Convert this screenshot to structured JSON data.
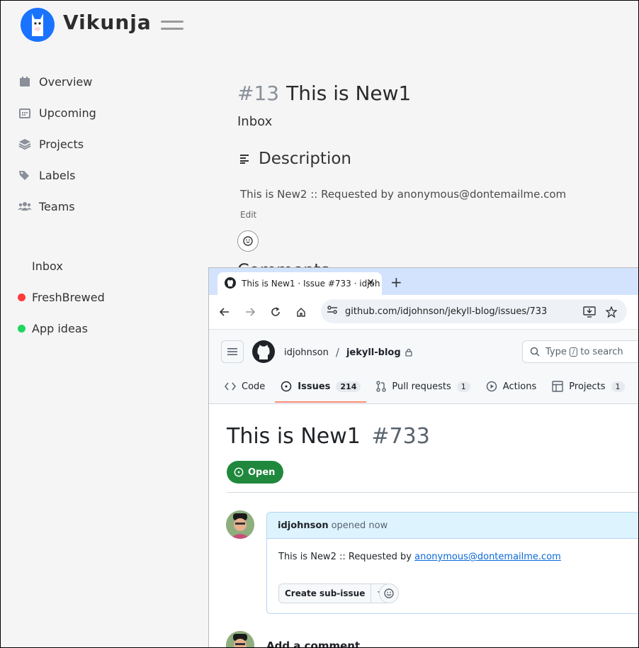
{
  "vikunja": {
    "brand": "Vikunja",
    "nav": [
      {
        "label": "Overview",
        "icon": "calendar-icon"
      },
      {
        "label": "Upcoming",
        "icon": "calendar-grid-icon"
      },
      {
        "label": "Projects",
        "icon": "layers-icon"
      },
      {
        "label": "Labels",
        "icon": "tags-icon"
      },
      {
        "label": "Teams",
        "icon": "users-icon"
      }
    ],
    "projects": [
      {
        "label": "Inbox",
        "color": ""
      },
      {
        "label": "FreshBrewed",
        "color": "#ff3b3b"
      },
      {
        "label": "App ideas",
        "color": "#1ed760"
      }
    ],
    "task": {
      "number": "#13",
      "title": "This is New1",
      "project": "Inbox",
      "description_heading": "Description",
      "description": "This is New2 :: Requested by anonymous@dontemailme.com",
      "edit_label": "Edit",
      "comments_heading": "Comments"
    }
  },
  "browser": {
    "tab_title": "This is New1 · Issue #733 · idjoh",
    "url": "github.com/idjohnson/jekyll-blog/issues/733"
  },
  "github": {
    "owner": "idjohnson",
    "repo": "jekyll-blog",
    "search_prefix": "Type",
    "search_key": "/",
    "search_suffix": "to search",
    "tabs": [
      {
        "label": "Code",
        "count": ""
      },
      {
        "label": "Issues",
        "count": "214"
      },
      {
        "label": "Pull requests",
        "count": "1"
      },
      {
        "label": "Actions",
        "count": ""
      },
      {
        "label": "Projects",
        "count": "1"
      }
    ],
    "issue": {
      "title": "This is New1",
      "number": "#733",
      "state": "Open",
      "comment_author": "idjohnson",
      "comment_meta": "opened now",
      "comment_text": "This is New2 :: Requested by ",
      "comment_link": "anonymous@dontemailme.com",
      "sub_issue_label": "Create sub-issue",
      "add_comment": "Add a comment"
    }
  }
}
